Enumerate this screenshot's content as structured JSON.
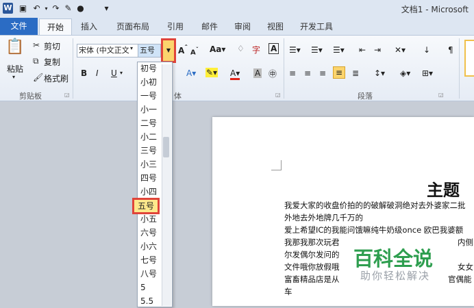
{
  "title_bar": {
    "document_title": "文档1 - Microsoft"
  },
  "tabs": [
    "文件",
    "开始",
    "插入",
    "页面布局",
    "引用",
    "邮件",
    "审阅",
    "视图",
    "开发工具"
  ],
  "clipboard": {
    "paste": "粘贴",
    "cut": "剪切",
    "copy": "复制",
    "format_painter": "格式刷",
    "group_label": "剪贴板"
  },
  "font": {
    "font_name": "宋体 (中文正文",
    "font_size": "五号",
    "group_label": "体"
  },
  "paragraph": {
    "group_label": "段落"
  },
  "font_size_options": [
    "初号",
    "小初",
    "一号",
    "小一",
    "二号",
    "小二",
    "三号",
    "小三",
    "四号",
    "小四",
    "五号",
    "小五",
    "六号",
    "小六",
    "七号",
    "八号",
    "5",
    "5.5"
  ],
  "selected_size": "五号",
  "document": {
    "heading": "主题",
    "lines": [
      "我爱大家的收盘价拍的的破解破洞绝对去外婆家二批",
      "外地去外地牌几千万的",
      "爱上希望IC的我能问饿嘛纯牛奶级once 欧巴我婆额",
      "我那我那次玩君",
      "尔发偶尔发问的",
      "文件哦你放假哦",
      "富畜精品店是从",
      "车"
    ],
    "right_fragments": [
      "内侧",
      "女女",
      "官偶能"
    ]
  },
  "watermark": {
    "title": "百科全说",
    "subtitle": "助你轻松解决"
  }
}
